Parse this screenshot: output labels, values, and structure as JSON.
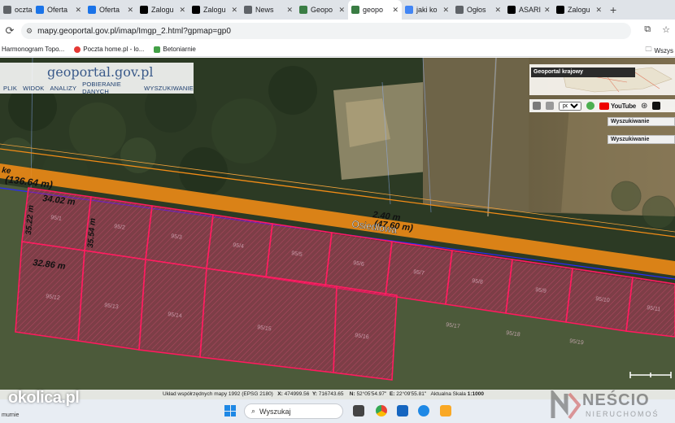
{
  "tabs": [
    {
      "label": "ocztа",
      "icon": "globe-icon",
      "color": "#5f6368"
    },
    {
      "label": "Oferta",
      "icon": "search-icon",
      "color": "#1a73e8"
    },
    {
      "label": "Oferta",
      "icon": "search-icon",
      "color": "#1a73e8"
    },
    {
      "label": "Zalogu",
      "icon": "a-logo-icon",
      "color": "#000000"
    },
    {
      "label": "Zalogu",
      "icon": "a-logo-icon",
      "color": "#000000"
    },
    {
      "label": "News",
      "icon": "globe-icon",
      "color": "#5f6368"
    },
    {
      "label": "Geopo",
      "icon": "map-icon",
      "color": "#3a7d44"
    },
    {
      "label": "geopo",
      "icon": "map-icon",
      "color": "#3a7d44",
      "active": true
    },
    {
      "label": "jaki ko",
      "icon": "google-icon",
      "color": "#4285f4"
    },
    {
      "label": "Ogłos",
      "icon": "globe-icon",
      "color": "#5f6368"
    },
    {
      "label": "ASARI",
      "icon": "a-logo-icon",
      "color": "#000000"
    },
    {
      "label": "Zalogu",
      "icon": "a-logo-icon",
      "color": "#000000"
    }
  ],
  "address": {
    "url": "mapy.geoportal.gov.pl/imap/Imgp_2.html?gpmap=gp0"
  },
  "bookmarks": [
    {
      "label": "Harmonogram Topo...",
      "color": "#ffffff"
    },
    {
      "label": "Poczta home.pl - lo...",
      "color": "#e53935"
    },
    {
      "label": "Betoniarnie",
      "color": "#43a047"
    }
  ],
  "bookmarks_right": "Wszys",
  "geoportal": {
    "logo": "geoportal.gov.pl",
    "menu": [
      "PLIK",
      "WIDOK",
      "ANALIZY",
      "POBIERANIE DANYCH",
      "WYSZUKIWANIE"
    ],
    "krajowy_label": "Geoportal krajowy",
    "language": "pol",
    "youtube": "YouTube",
    "search_rows": [
      "Wyszukiwanie",
      "Wyszukiwanie"
    ]
  },
  "map": {
    "street_name": "Osiedlowa",
    "labels": {
      "top_length": "(136.64 m)",
      "top_partial": "ke",
      "parcel_width": "34.02 m",
      "left_side": "35.22 m",
      "inner_side": "35.54 m",
      "bottom_width": "32.86 m",
      "road_width": "2.40 m",
      "road_length": "(47.60 m)"
    },
    "parcel_ids": [
      "95/1",
      "95/2",
      "95/3",
      "95/4",
      "95/5",
      "95/6",
      "95/7",
      "95/8",
      "95/9",
      "95/10",
      "95/11",
      "95/12",
      "95/13",
      "95/14",
      "95/15",
      "95/16",
      "95/17",
      "95/18",
      "95/19"
    ]
  },
  "status": {
    "label": "Układ współrzędnych mapy 1992 (EPSG 2180)",
    "x_label": "X:",
    "x": "474999.56",
    "y_label": "Y:",
    "y": "716743.65",
    "n_label": "N:",
    "n": "52°05'54.97\"",
    "e_label": "E:",
    "e": "22°09'55.81\"",
    "scale_label": "Aktualna Skala",
    "scale": "1:1000"
  },
  "taskbar": {
    "search_placeholder": "Wyszukaj",
    "left_text": "murnie"
  },
  "watermark": {
    "left": "okolica.pl",
    "right": "NEŚCIO",
    "right_sub": "NIERUCHOMOŚ"
  },
  "colors": {
    "parcel_fill": "#c2185b",
    "parcel_line": "#ff1a5e",
    "road": "#f28c16",
    "boundary": "#2a2aff"
  }
}
